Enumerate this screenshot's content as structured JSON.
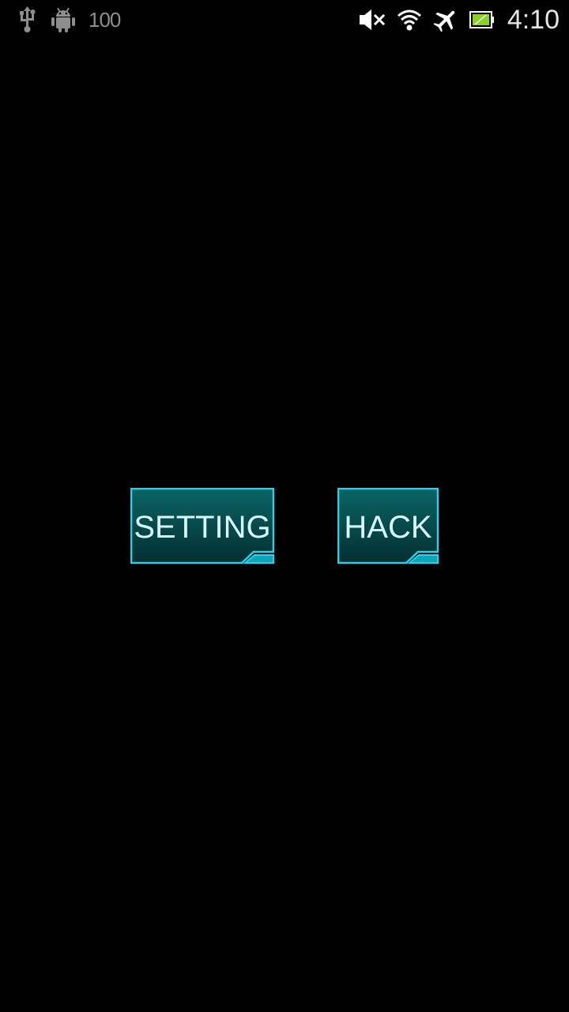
{
  "status_bar": {
    "battery_level_text": "100",
    "clock": "4:10",
    "left_icons": [
      "usb-icon",
      "android-debug-icon"
    ],
    "right_icons": [
      "mute-icon",
      "wifi-icon",
      "airplane-mode-icon",
      "battery-charging-icon"
    ]
  },
  "main": {
    "setting_label": "SETTING",
    "hack_label": "HACK"
  },
  "colors": {
    "background": "#000000",
    "button_border": "#1fd6ec",
    "button_fill_top": "#0a5e60",
    "button_fill_bottom": "#06393b",
    "button_text": "#d7fbff",
    "battery_fill": "#8cd12a"
  }
}
